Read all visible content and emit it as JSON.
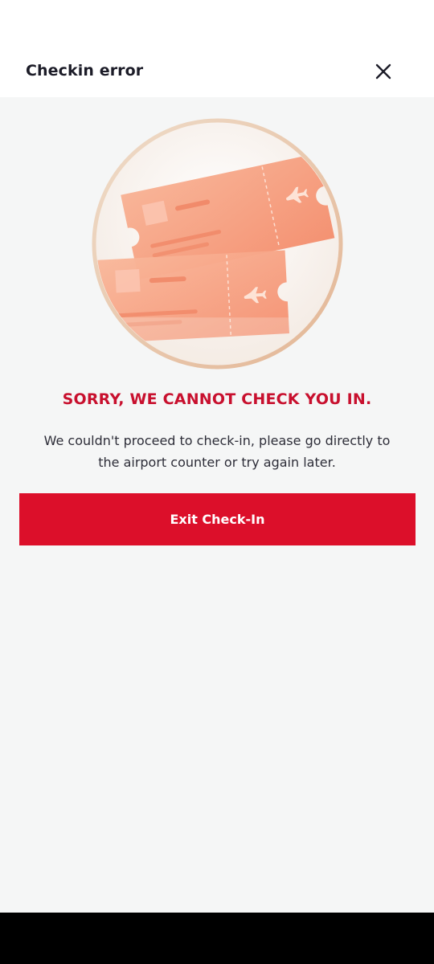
{
  "header": {
    "title": "Checkin error",
    "close_icon": "close-icon"
  },
  "illustration": {
    "icon": "boarding-passes-illustration",
    "colors": {
      "circle_border": "#e8c9ae",
      "ticket": "#f59a7c"
    }
  },
  "error": {
    "title": "SORRY, WE CANNOT CHECK YOU IN.",
    "message": "We couldn't proceed to check-in, please go directly to the airport counter or try again later."
  },
  "actions": {
    "exit_label": "Exit Check-In"
  },
  "colors": {
    "accent": "#dc0f2a",
    "title_red": "#c8102e",
    "background": "#f5f6f6"
  }
}
